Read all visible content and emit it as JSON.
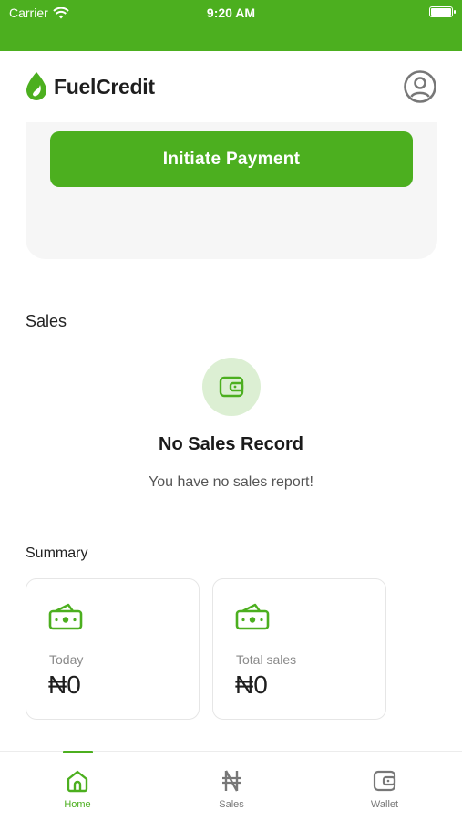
{
  "status_bar": {
    "carrier": "Carrier",
    "time": "9:20 AM"
  },
  "header": {
    "brand": "FuelCredit",
    "profile_icon": "user-circle-icon"
  },
  "payment": {
    "button_label": "Initiate Payment"
  },
  "sales": {
    "title": "Sales",
    "empty_icon": "wallet-icon",
    "empty_title": "No Sales Record",
    "empty_subtitle": "You have no sales report!"
  },
  "summary": {
    "title": "Summary",
    "cards": [
      {
        "label": "Today",
        "value": "₦0",
        "icon": "cash-icon"
      },
      {
        "label": "Total sales",
        "value": "₦0",
        "icon": "cash-icon"
      }
    ]
  },
  "nav": {
    "items": [
      {
        "label": "Home",
        "icon": "home-icon",
        "active": true
      },
      {
        "label": "Sales",
        "icon": "naira-icon",
        "active": false
      },
      {
        "label": "Wallet",
        "icon": "wallet-icon",
        "active": false
      }
    ]
  },
  "colors": {
    "brand_green": "#4caf1f",
    "light_green": "#dcefd3",
    "card_bg": "#f6f6f6"
  }
}
